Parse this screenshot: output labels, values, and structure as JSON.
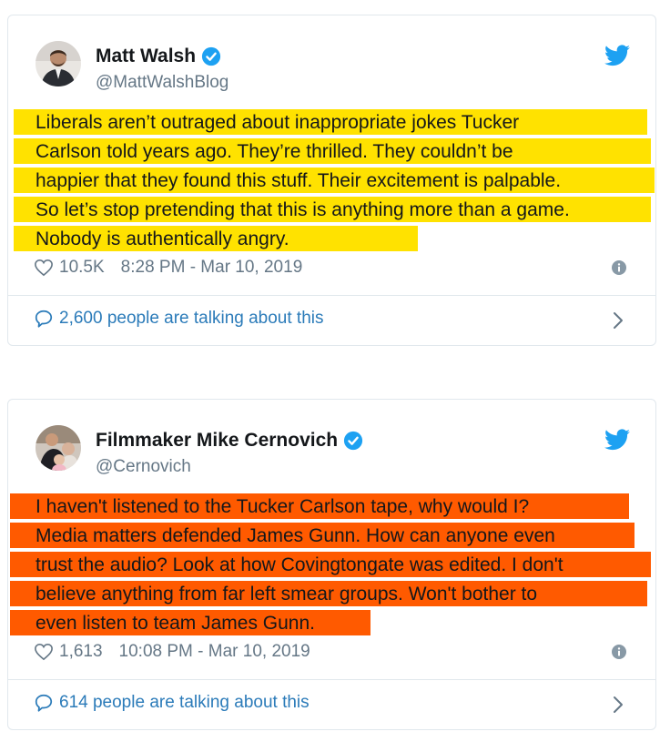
{
  "tweets": [
    {
      "author": "Matt Walsh",
      "handle": "@MattWalshBlog",
      "verified": true,
      "highlight_color": "#ffe200",
      "text_lines": [
        "Liberals aren’t outraged about inappropriate jokes Tucker",
        "Carlson told years ago. They’re thrilled. They couldn’t be",
        "happier that they found this stuff. Their excitement is palpable.",
        "So let’s stop pretending that this is anything more than a game.",
        "Nobody is authentically angry."
      ],
      "likes": "10.5K",
      "timestamp": "8:28 PM - Mar 10, 2019",
      "talking": "2,600 people are talking about this"
    },
    {
      "author": "Filmmaker Mike Cernovich",
      "handle": "@Cernovich",
      "verified": true,
      "highlight_color": "#ff5a00",
      "text_lines": [
        "I haven't listened to the Tucker Carlson tape, why would I?",
        "Media matters defended James Gunn. How can anyone even",
        "trust the audio? Look at how Covingtongate was edited. I don't",
        "believe anything from far left smear groups. Won't bother to",
        "even listen to team James Gunn."
      ],
      "likes": "1,613",
      "timestamp": "10:08 PM - Mar 10, 2019",
      "talking": "614 people are talking about this"
    }
  ],
  "icons": {
    "verified": "verified-badge-icon",
    "bird": "twitter-bird-icon",
    "heart": "heart-icon",
    "info": "info-icon",
    "bubble": "speech-bubble-icon",
    "chevron": "chevron-right-icon"
  },
  "colors": {
    "link_blue": "#2b7bb9",
    "twitter_blue": "#1da1f2",
    "muted_gray": "#657786"
  }
}
